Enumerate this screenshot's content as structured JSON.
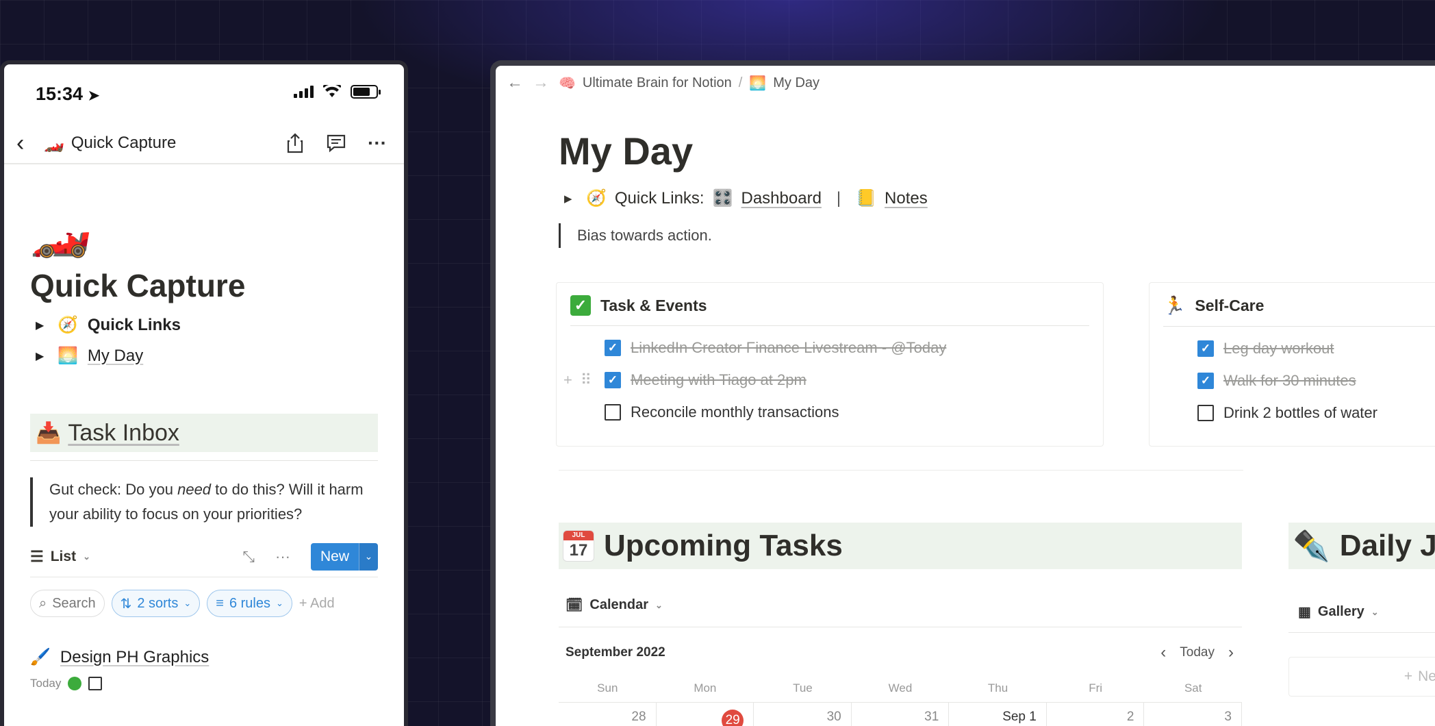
{
  "phone": {
    "status": {
      "time": "15:34"
    },
    "nav": {
      "title": "Quick Capture"
    },
    "page_title": "Quick Capture",
    "toggles": [
      {
        "label": "Quick Links"
      },
      {
        "label": "My Day"
      }
    ],
    "task_inbox": {
      "heading": "Task Inbox",
      "callout_before": "Gut check: Do you ",
      "callout_em": "need",
      "callout_after": " to do this? Will it harm your ability to focus on your priorities?"
    },
    "view": {
      "name": "List",
      "more": "···",
      "new_label": "New"
    },
    "filters": {
      "search": "Search",
      "sorts": "2 sorts",
      "rules": "6 rules",
      "add": "Add"
    },
    "task": {
      "title": "Design PH Graphics",
      "due": "Today"
    }
  },
  "desktop": {
    "breadcrumb": {
      "root": "Ultimate Brain for Notion",
      "separator": "/",
      "current": "My Day"
    },
    "page_title": "My Day",
    "quick_links": {
      "label": "Quick Links:",
      "link1": "Dashboard",
      "separator": "|",
      "link2": "Notes"
    },
    "quote": "Bias towards action.",
    "task_events": {
      "title": "Task & Events",
      "items": [
        {
          "text": "LinkedIn Creator Finance Livestream - @Today",
          "done": true
        },
        {
          "text": "Meeting with Tiago at 2pm",
          "done": true
        },
        {
          "text": "Reconcile monthly transactions",
          "done": false
        }
      ]
    },
    "self_care": {
      "title": "Self-Care",
      "items": [
        {
          "text": "Leg day workout",
          "done": true
        },
        {
          "text": "Walk for 30 minutes",
          "done": true
        },
        {
          "text": "Drink 2 bottles of water",
          "done": false
        }
      ]
    },
    "upcoming": {
      "title": "Upcoming Tasks",
      "cal_month_abbr": "JUL",
      "cal_day": "17",
      "view": "Calendar",
      "month": "September 2022",
      "today_btn": "Today",
      "weekdays": [
        "Sun",
        "Mon",
        "Tue",
        "Wed",
        "Thu",
        "Fri",
        "Sat"
      ],
      "days": [
        "28",
        "29",
        "30",
        "31",
        "Sep 1",
        "2",
        "3"
      ]
    },
    "daily_journal": {
      "title": "Daily J",
      "view": "Gallery",
      "new_label": "New"
    }
  }
}
